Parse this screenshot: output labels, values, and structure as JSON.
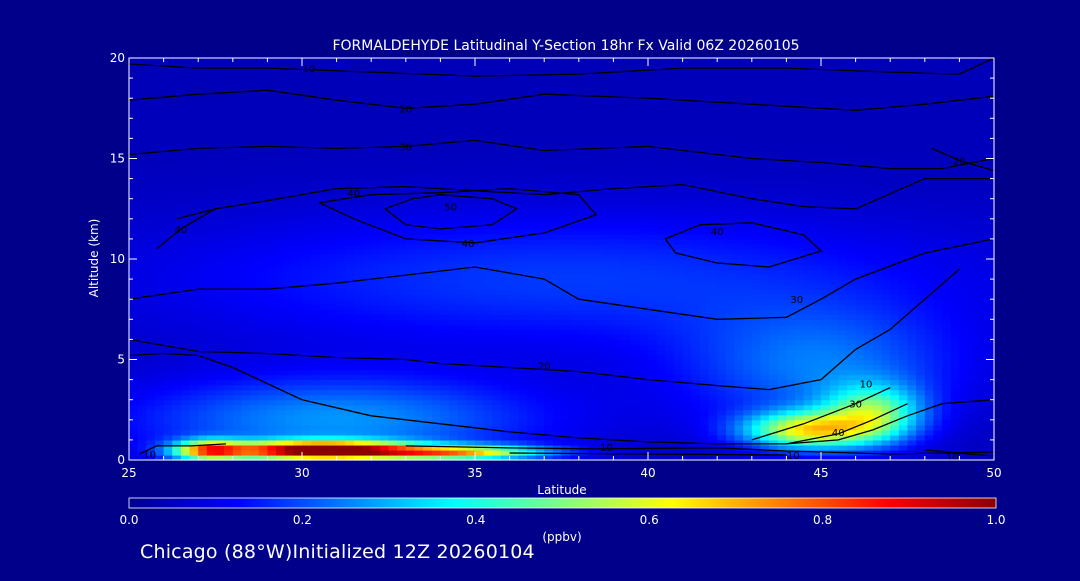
{
  "chart_data": {
    "type": "heatmap",
    "title": "FORMALDEHYDE Latitudinal Y-Section 18hr  Fx Valid 06Z 20260105",
    "xlabel": "Latitude",
    "ylabel": "Altitude (km)",
    "xlim": [
      25,
      50
    ],
    "ylim": [
      0,
      20
    ],
    "x_ticks": [
      "25",
      "30",
      "35",
      "40",
      "45",
      "50"
    ],
    "y_ticks": [
      "0",
      "5",
      "10",
      "15",
      "20"
    ],
    "colorbar": {
      "label": "(ppbv)",
      "range": [
        0.0,
        1.0
      ],
      "ticks": [
        "0.0",
        "0.2",
        "0.4",
        "0.6",
        "0.8",
        "1.0"
      ],
      "colors": [
        "#00008b",
        "#0000ff",
        "#0080ff",
        "#00ffff",
        "#80ff80",
        "#ffff00",
        "#ff8000",
        "#ff0000",
        "#8b0000"
      ]
    },
    "field": {
      "background_ppbv": 0.05,
      "features": [
        {
          "lat": 30.5,
          "alt": 0.5,
          "ppbv": 0.95,
          "lat_spread": 2.6,
          "alt_spread": 0.45
        },
        {
          "lat": 27.3,
          "alt": 0.5,
          "ppbv": 0.55,
          "lat_spread": 1.0,
          "alt_spread": 0.5
        },
        {
          "lat": 34.5,
          "alt": 0.4,
          "ppbv": 0.55,
          "lat_spread": 2.5,
          "alt_spread": 0.35
        },
        {
          "lat": 44.6,
          "alt": 1.5,
          "ppbv": 0.52,
          "lat_spread": 1.8,
          "alt_spread": 0.9
        },
        {
          "lat": 46.5,
          "alt": 2.3,
          "ppbv": 0.38,
          "lat_spread": 1.4,
          "alt_spread": 1.4
        },
        {
          "lat": 31.0,
          "alt": 2.0,
          "ppbv": 0.22,
          "lat_spread": 6.0,
          "alt_spread": 2.2
        },
        {
          "lat": 45.0,
          "alt": 4.5,
          "ppbv": 0.18,
          "lat_spread": 4.0,
          "alt_spread": 3.0
        },
        {
          "lat": 37.5,
          "alt": 9.0,
          "ppbv": 0.13,
          "lat_spread": 12.0,
          "alt_spread": 3.5
        }
      ]
    },
    "contours": {
      "color": "#000000",
      "lines": [
        {
          "level": "10",
          "points": [
            [
              25,
              19.7
            ],
            [
              27,
              19.5
            ],
            [
              29,
              19.5
            ],
            [
              32,
              19.3
            ],
            [
              35,
              19.1
            ],
            [
              38,
              19.2
            ],
            [
              41,
              19.5
            ],
            [
              44,
              19.5
            ],
            [
              47,
              19.3
            ],
            [
              49,
              19.2
            ],
            [
              50,
              20
            ]
          ],
          "label_at": [
            30.2,
            19.5
          ]
        },
        {
          "level": "20",
          "points": [
            [
              25,
              17.9
            ],
            [
              27,
              18.2
            ],
            [
              29,
              18.4
            ],
            [
              31,
              17.9
            ],
            [
              33,
              17.5
            ],
            [
              35,
              17.7
            ],
            [
              37,
              18.2
            ],
            [
              40,
              18.0
            ],
            [
              43,
              17.7
            ],
            [
              46,
              17.4
            ],
            [
              48,
              17.7
            ],
            [
              50,
              18.1
            ]
          ],
          "label_at": [
            33.0,
            17.5
          ]
        },
        {
          "level": "30",
          "points": [
            [
              25,
              15.2
            ],
            [
              27,
              15.5
            ],
            [
              29,
              15.6
            ],
            [
              31,
              15.5
            ],
            [
              33,
              15.6
            ],
            [
              35,
              15.9
            ],
            [
              37,
              15.4
            ],
            [
              40,
              15.6
            ],
            [
              43,
              15.0
            ],
            [
              45,
              14.8
            ],
            [
              47,
              14.5
            ],
            [
              48.5,
              14.5
            ],
            [
              50,
              15.0
            ]
          ],
          "label_at": [
            33.0,
            15.6
          ]
        },
        {
          "level": "20",
          "points": [
            [
              48.2,
              15.5
            ],
            [
              49.0,
              14.9
            ],
            [
              50,
              14.4
            ]
          ],
          "label_at": [
            49.0,
            14.9
          ]
        },
        {
          "level": "40",
          "points": [
            [
              26.4,
              12.0
            ],
            [
              27.5,
              12.5
            ],
            [
              29,
              12.9
            ],
            [
              31,
              13.5
            ],
            [
              33,
              13.6
            ],
            [
              35,
              13.4
            ],
            [
              37,
              13.2
            ],
            [
              39,
              13.5
            ],
            [
              41,
              13.7
            ],
            [
              43,
              13.0
            ],
            [
              44.5,
              12.6
            ],
            [
              46,
              12.5
            ],
            [
              48,
              14.0
            ],
            [
              50,
              14.0
            ]
          ],
          "label_at": [
            31.5,
            13.3
          ]
        },
        {
          "level": "40",
          "points": [
            [
              25.8,
              10.5
            ],
            [
              26.5,
              11.5
            ],
            [
              27.5,
              12.5
            ]
          ],
          "label_at": [
            26.5,
            11.5
          ]
        },
        {
          "level": "50",
          "points": [
            [
              32.4,
              12.5
            ],
            [
              33.2,
              13.0
            ],
            [
              34,
              13.2
            ],
            [
              35.5,
              13.0
            ],
            [
              36.2,
              12.5
            ],
            [
              35.5,
              11.7
            ],
            [
              34,
              11.5
            ],
            [
              33,
              11.7
            ],
            [
              32.4,
              12.5
            ]
          ],
          "label_at": [
            34.3,
            12.6
          ]
        },
        {
          "level": "40",
          "points": [
            [
              30.5,
              12.8
            ],
            [
              31.5,
              12.0
            ],
            [
              33,
              11.0
            ],
            [
              35,
              10.8
            ],
            [
              37,
              11.3
            ],
            [
              38.5,
              12.2
            ],
            [
              38,
              13.2
            ],
            [
              36,
              13.5
            ],
            [
              34,
              13.3
            ],
            [
              32,
              13.2
            ],
            [
              30.5,
              12.8
            ]
          ],
          "label_at": [
            34.8,
            10.8
          ]
        },
        {
          "level": "40",
          "points": [
            [
              40.5,
              11.0
            ],
            [
              41.5,
              11.7
            ],
            [
              43,
              11.8
            ],
            [
              44.5,
              11.2
            ],
            [
              45,
              10.4
            ],
            [
              43.5,
              9.6
            ],
            [
              42,
              9.8
            ],
            [
              40.8,
              10.3
            ],
            [
              40.5,
              11.0
            ]
          ],
          "label_at": [
            42.0,
            11.4
          ]
        },
        {
          "level": "30",
          "points": [
            [
              25,
              8.0
            ],
            [
              27,
              8.5
            ],
            [
              29,
              8.5
            ],
            [
              31,
              8.8
            ],
            [
              33,
              9.2
            ],
            [
              35,
              9.6
            ],
            [
              37,
              9.0
            ],
            [
              38,
              8.0
            ],
            [
              40,
              7.5
            ],
            [
              42,
              7.0
            ],
            [
              44,
              7.1
            ],
            [
              45,
              8.0
            ],
            [
              46,
              9.0
            ],
            [
              48,
              10.3
            ],
            [
              50,
              11.0
            ]
          ],
          "label_at": [
            44.3,
            8.0
          ]
        },
        {
          "level": "20",
          "points": [
            [
              25,
              6.0
            ],
            [
              27,
              5.4
            ],
            [
              29,
              5.3
            ],
            [
              31,
              5.1
            ],
            [
              33,
              5.0
            ],
            [
              34,
              4.8
            ],
            [
              36,
              4.6
            ],
            [
              38,
              4.4
            ],
            [
              40,
              4.0
            ],
            [
              42,
              3.7
            ],
            [
              43.5,
              3.5
            ],
            [
              45,
              4.0
            ],
            [
              46,
              5.5
            ],
            [
              47,
              6.5
            ],
            [
              48,
              8.0
            ],
            [
              49,
              9.5
            ]
          ],
          "label_at": [
            37.0,
            4.7
          ]
        },
        {
          "level": "10",
          "points": [
            [
              25,
              5.2
            ],
            [
              26,
              5.3
            ],
            [
              27,
              5.2
            ],
            [
              28,
              4.6
            ],
            [
              29,
              3.8
            ],
            [
              30,
              3.0
            ],
            [
              32,
              2.2
            ],
            [
              34,
              1.8
            ],
            [
              36,
              1.4
            ],
            [
              38,
              1.1
            ],
            [
              40,
              0.9
            ],
            [
              42,
              0.8
            ],
            [
              44,
              0.8
            ],
            [
              45.5,
              1.0
            ],
            [
              46.5,
              1.5
            ],
            [
              47.5,
              2.2
            ],
            [
              48.5,
              2.8
            ],
            [
              50,
              3.0
            ]
          ],
          "label_at": [
            46.3,
            3.8
          ]
        },
        {
          "level": "10",
          "points": [
            [
              33,
              0.7
            ],
            [
              36,
              0.6
            ],
            [
              38.5,
              0.55
            ],
            [
              42,
              0.6
            ],
            [
              44,
              0.45
            ],
            [
              47,
              0.3
            ],
            [
              50,
              0.4
            ]
          ],
          "label_at": [
            38.8,
            0.65
          ]
        },
        {
          "level": "30",
          "points": [
            [
              43,
              1.0
            ],
            [
              44.5,
              1.8
            ],
            [
              46,
              2.8
            ],
            [
              47,
              3.6
            ]
          ],
          "label_at": [
            46.0,
            2.8
          ]
        },
        {
          "level": "40",
          "points": [
            [
              44,
              0.8
            ],
            [
              45.5,
              1.3
            ],
            [
              46.5,
              2.0
            ],
            [
              47.5,
              2.8
            ]
          ],
          "label_at": [
            45.5,
            1.4
          ]
        },
        {
          "level": "10",
          "points": [
            [
              25.3,
              0.3
            ],
            [
              25.8,
              0.7
            ],
            [
              26.8,
              0.7
            ],
            [
              27.8,
              0.8
            ]
          ],
          "label_at": [
            25.6,
            0.3
          ]
        },
        {
          "level": "10",
          "points": [
            [
              36,
              0.35
            ],
            [
              40,
              0.3
            ],
            [
              44,
              0.25
            ]
          ],
          "label_at": [
            44.2,
            0.25
          ]
        },
        {
          "level": "10",
          "points": [
            [
              48,
              0.5
            ],
            [
              49.3,
              0.3
            ],
            [
              50,
              0.2
            ]
          ],
          "label_at": [
            48.8,
            0.2
          ]
        }
      ]
    }
  },
  "footer": {
    "text": "Chicago (88°W)Initialized 12Z 20260104"
  }
}
